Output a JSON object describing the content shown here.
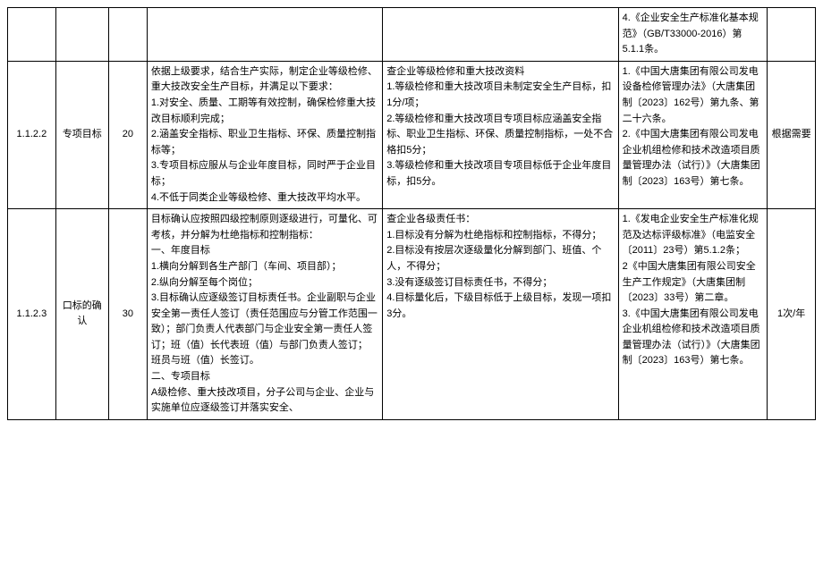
{
  "rows": [
    {
      "c1": "",
      "c2": "",
      "c3": "",
      "c4": "",
      "c5": "",
      "c6": "4.《企业安全生产标准化基本规范》（GB/T33000-2016）第5.1.1条。",
      "c7": ""
    },
    {
      "c1": "1.1.2.2",
      "c2": "专项目标",
      "c3": "20",
      "c4": "依据上级要求，结合生产实际，制定企业等级检修、重大技改安全生产目标，并满足以下要求：\n1.对安全、质量、工期等有效控制，确保检修重大技改目标顺利完成；\n2.涵盖安全指标、职业卫生指标、环保、质量控制指标等；\n3.专项目标应服从与企业年度目标，同时严于企业目标；\n4.不低于同类企业等级检修、重大技改平均水平。",
      "c5": "查企业等级检修和重大技改资料\n1.等级检修和重大技改项目未制定安全生产目标，扣1分/项；\n2.等级检修和重大技改项目专项目标应涵盖安全指标、职业卫生指标、环保、质量控制指标，一处不合格扣5分；\n3.等级检修和重大技改项目专项目标低于企业年度目标，扣5分。",
      "c6": "1.《中国大唐集团有限公司发电设备检修管理办法》（大唐集团制〔2023〕162号）第九条、第二十六条。\n2.《中国大唐集团有限公司发电企业机组检修和技术改造项目质量管理办法（试行）》（大唐集团制〔2023〕163号）第七条。",
      "c7": "根据需要"
    },
    {
      "c1": "1.1.2.3",
      "c2": "口标的确认",
      "c3": "30",
      "c4": "目标确认应按照四级控制原则逐级进行，可量化、可考核，并分解为杜绝指标和控制指标：\n一、年度目标\n1.横向分解到各生产部门（车间、项目部）；\n2.纵向分解至每个岗位；\n3.目标确认应逐级签订目标责任书。企业副职与企业安全第一责任人签订（责任范围应与分管工作范围一致）；部门负责人代表部门与企业安全第一责任人签订；班（值）长代表班（值）与部门负责人签订；\n班员与班（值）长签订。\n二、专项目标\nA级检修、重大技改项目，分子公司与企业、企业与实施单位应逐级签订并落实安全、",
      "c5": "查企业各级责任书：\n1.目标没有分解为杜绝指标和控制指标，不得分；\n2.目标没有按层次逐级量化分解到部门、班值、个人，不得分；\n3.没有逐级签订目标责任书，不得分；\n4.目标量化后，下级目标低于上级目标，发现一项扣3分。",
      "c6": "1.《发电企业安全生产标准化规范及达标评级标准》（电监安全〔2011〕23号）第5.1.2条；\n2《中国大唐集团有限公司安全生产工作规定》（大唐集团制〔2023〕33号）第二章。\n3.《中国大唐集团有限公司发电企业机组检修和技术改造项目质量管理办法（试行）》（大唐集团制〔2023〕163号）第七条。",
      "c7": "1次/年"
    }
  ]
}
